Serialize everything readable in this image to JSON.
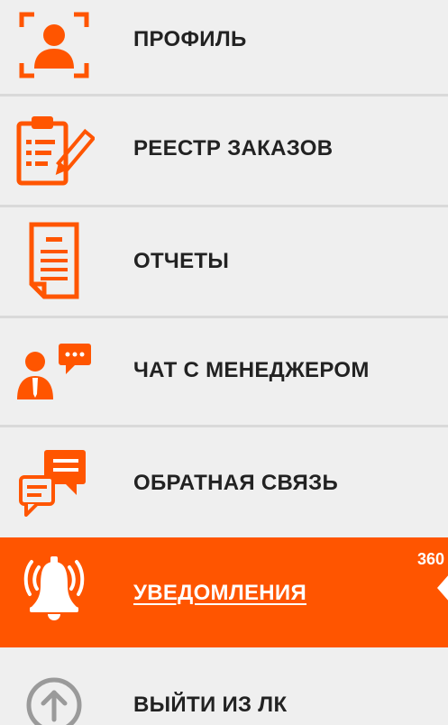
{
  "menu": {
    "accent_color": "#ff5500",
    "items": [
      {
        "label": "ПРОФИЛЬ",
        "icon": "profile-icon",
        "active": false
      },
      {
        "label": "РЕЕСТР ЗАКАЗОВ",
        "icon": "order-registry-icon",
        "active": false
      },
      {
        "label": "ОТЧЕТЫ",
        "icon": "reports-icon",
        "active": false
      },
      {
        "label": "ЧАТ С МЕНЕДЖЕРОМ",
        "icon": "manager-chat-icon",
        "active": false
      },
      {
        "label": "ОБРАТНАЯ СВЯЗЬ",
        "icon": "feedback-icon",
        "active": false
      },
      {
        "label": "УВЕДОМЛЕНИЯ",
        "icon": "bell-icon",
        "active": true,
        "badge": "360"
      },
      {
        "label": "ВЫЙТИ ИЗ ЛК",
        "icon": "logout-icon",
        "active": false
      }
    ]
  }
}
